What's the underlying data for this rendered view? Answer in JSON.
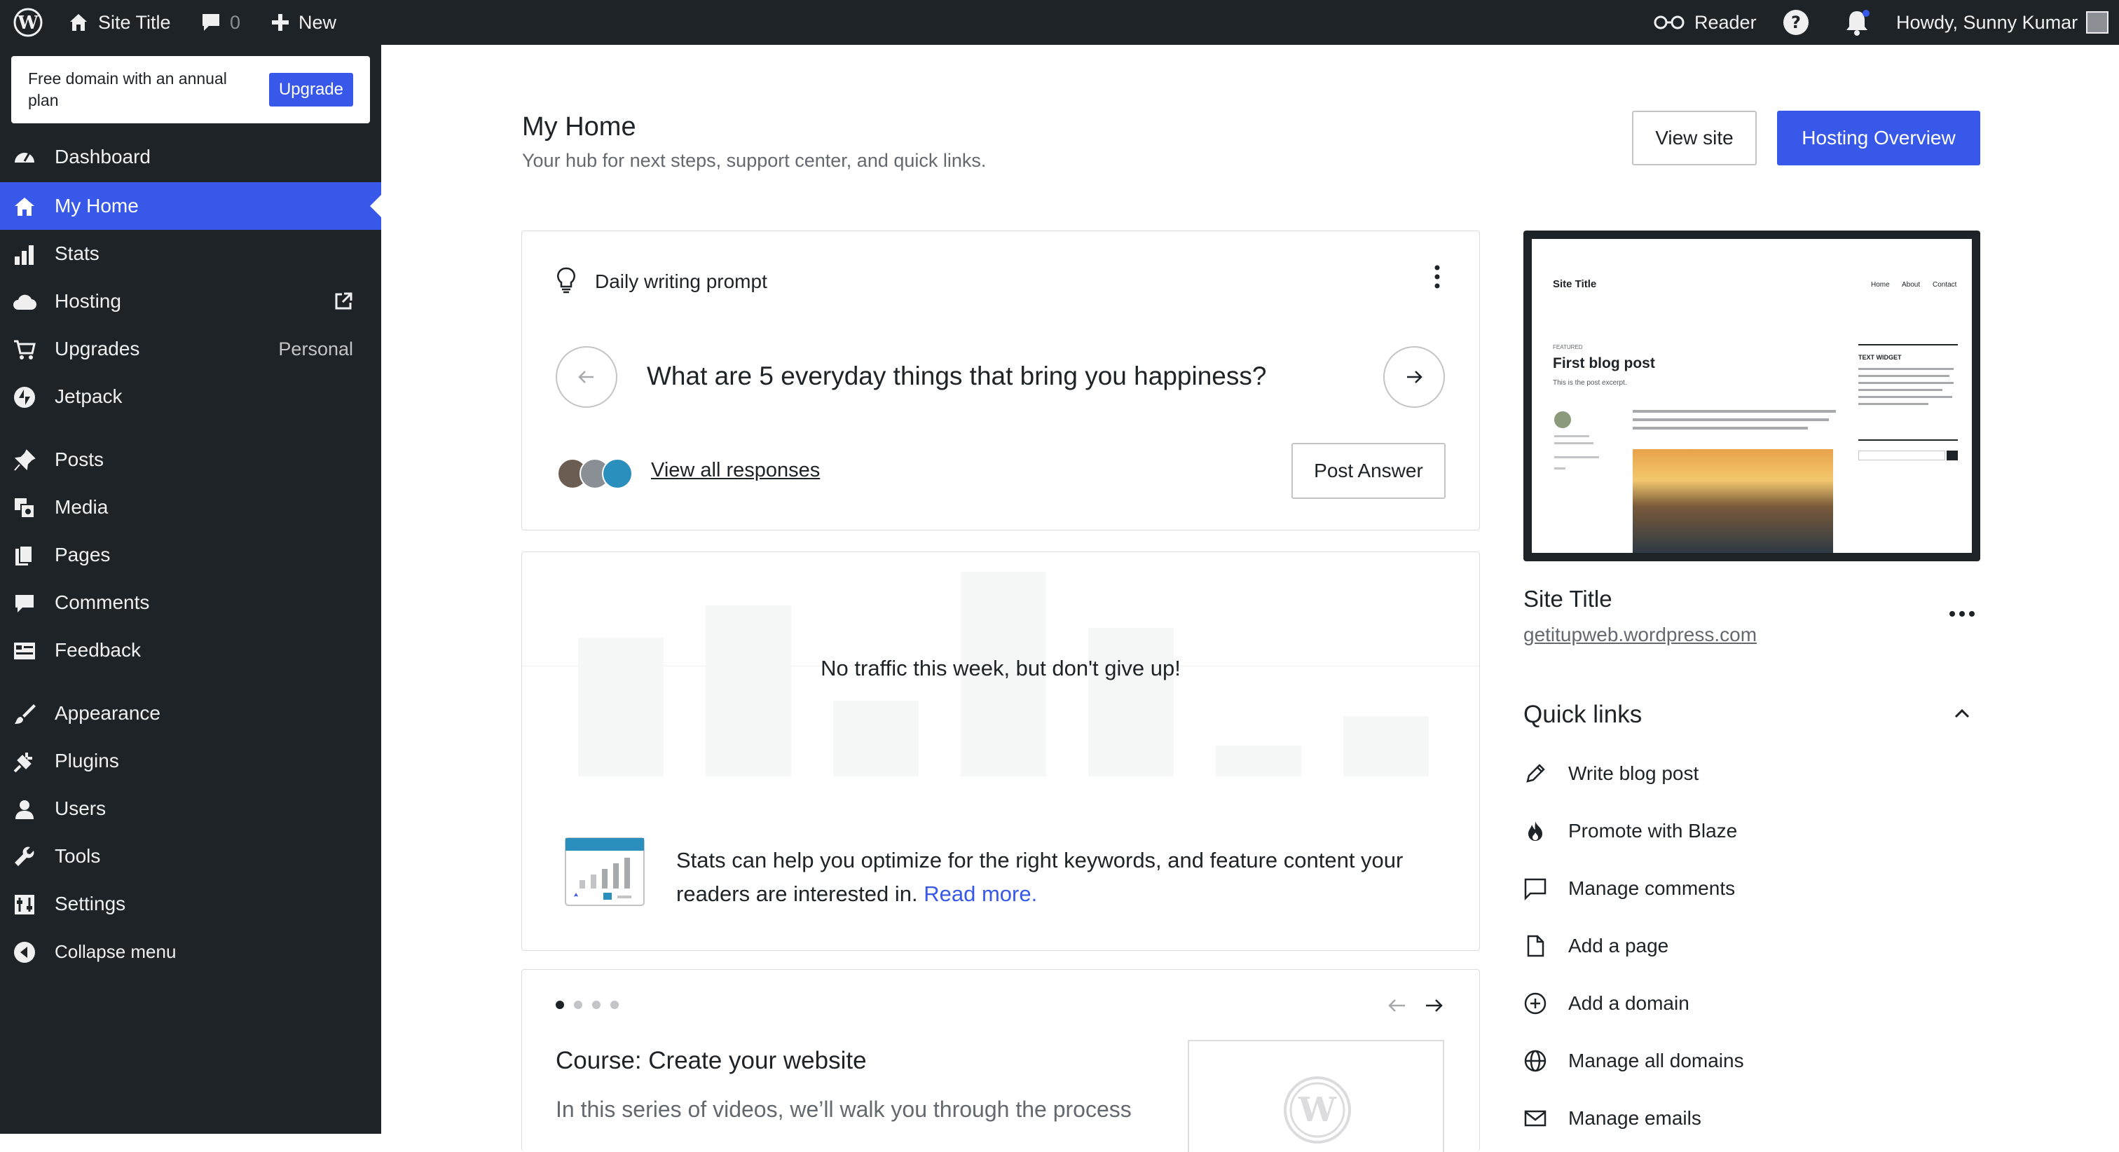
{
  "adminbar": {
    "site_title": "Site Title",
    "comment_count": "0",
    "new_label": "New",
    "reader_label": "Reader",
    "greeting": "Howdy, Sunny Kumar"
  },
  "sidebar": {
    "promo_text": "Free domain with an annual plan",
    "promo_button": "Upgrade",
    "items": [
      {
        "label": "Dashboard",
        "icon": "dashboard-icon"
      },
      {
        "label": "My Home",
        "icon": "home-icon"
      },
      {
        "label": "Stats",
        "icon": "stats-icon"
      },
      {
        "label": "Hosting",
        "icon": "cloud-icon"
      },
      {
        "label": "Upgrades",
        "icon": "cart-icon",
        "extra": "Personal"
      },
      {
        "label": "Jetpack",
        "icon": "jetpack-icon"
      },
      {
        "label": "Posts",
        "icon": "pin-icon"
      },
      {
        "label": "Media",
        "icon": "media-icon"
      },
      {
        "label": "Pages",
        "icon": "pages-icon"
      },
      {
        "label": "Comments",
        "icon": "comment-icon"
      },
      {
        "label": "Feedback",
        "icon": "feedback-icon"
      },
      {
        "label": "Appearance",
        "icon": "brush-icon"
      },
      {
        "label": "Plugins",
        "icon": "plug-icon"
      },
      {
        "label": "Users",
        "icon": "user-icon"
      },
      {
        "label": "Tools",
        "icon": "wrench-icon"
      },
      {
        "label": "Settings",
        "icon": "settings-icon"
      },
      {
        "label": "Collapse menu",
        "icon": "collapse-icon"
      }
    ]
  },
  "header": {
    "title": "My Home",
    "subtitle": "Your hub for next steps, support center, and quick links.",
    "view_site": "View site",
    "hosting_overview": "Hosting Overview"
  },
  "prompt": {
    "label": "Daily writing prompt",
    "question": "What are 5 everyday things that bring you happiness?",
    "view_responses": "View all responses",
    "post_answer": "Post Answer"
  },
  "stats": {
    "no_traffic": "No traffic this week, but don't give up!",
    "tip": "Stats can help you optimize for the right keywords, and feature content your readers are interested in.",
    "read_more": "Read more."
  },
  "course": {
    "title": "Course: Create your website",
    "description": "In this series of videos, we’ll walk you through the process"
  },
  "site_card": {
    "preview": {
      "site_title": "Site Title",
      "nav": [
        "Home",
        "About",
        "Contact"
      ],
      "featured": "FEATURED",
      "post_title": "First blog post",
      "excerpt": "This is the post excerpt.",
      "widget_title": "TEXT WIDGET"
    },
    "name": "Site Title",
    "url": "getitupweb.wordpress.com"
  },
  "quick_links": {
    "title": "Quick links",
    "items": [
      {
        "label": "Write blog post",
        "icon": "pencil-icon"
      },
      {
        "label": "Promote with Blaze",
        "icon": "flame-icon"
      },
      {
        "label": "Manage comments",
        "icon": "comment-outline-icon"
      },
      {
        "label": "Add a page",
        "icon": "page-icon"
      },
      {
        "label": "Add a domain",
        "icon": "plus-circle-icon"
      },
      {
        "label": "Manage all domains",
        "icon": "globe-icon"
      },
      {
        "label": "Manage emails",
        "icon": "mail-icon"
      }
    ]
  },
  "colors": {
    "accent": "#3858e9",
    "adminbar": "#1d2327"
  }
}
